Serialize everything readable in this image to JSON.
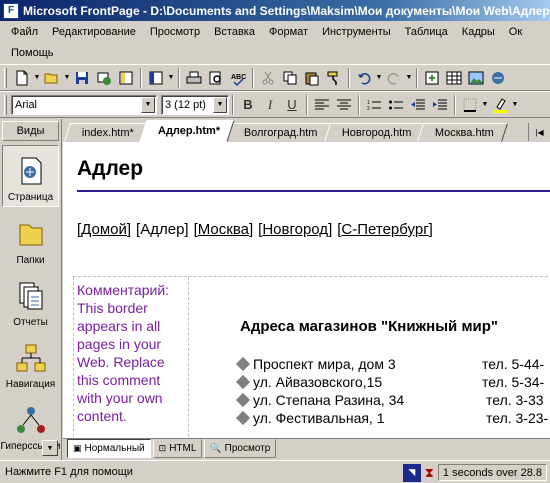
{
  "window": {
    "title": "Microsoft FrontPage - D:\\Documents and Settings\\Maksim\\Мои документы\\Мои Web\\Адлер.htm"
  },
  "menu": {
    "row1": [
      "Файл",
      "Редактирование",
      "Просмотр",
      "Вставка",
      "Формат",
      "Инструменты",
      "Таблица",
      "Кадры",
      "Ок"
    ],
    "row2": [
      "Помощь"
    ]
  },
  "format_toolbar": {
    "font": "Arial",
    "size": "3  (12 pt)"
  },
  "views": {
    "title": "Виды",
    "items": [
      "Страница",
      "Папки",
      "Отчеты",
      "Навигация",
      "Гиперссылки"
    ]
  },
  "tabs": [
    "index.htm*",
    "Адлер.htm*",
    "Волгоград.htm",
    "Новгород.htm",
    "Москва.htm"
  ],
  "page": {
    "title": "Адлер",
    "nav": [
      "Домой",
      "Адлер",
      "Москва",
      "Новгород",
      "С-Петербург"
    ],
    "comment": "Комментарий: This border appears in all pages in your Web. Replace this comment with your own content.",
    "stores_title": "Адреса магазинов \"Книжный мир\"",
    "stores": [
      {
        "address": "Проспект мира, дом 3",
        "phone": "тел. 5-44-"
      },
      {
        "address": "ул. Айвазовского,15",
        "phone": "тел. 5-34-"
      },
      {
        "address": "ул. Степана Разина, 34",
        "phone": "тел. 3-33"
      },
      {
        "address": "ул. Фестивальная, 1",
        "phone": "тел. 3-23-"
      }
    ]
  },
  "view_tabs": [
    "Нормальный",
    "HTML",
    "Просмотр"
  ],
  "status": {
    "help": "Нажмите F1 для помощи",
    "speed": "1 seconds over 28.8"
  }
}
